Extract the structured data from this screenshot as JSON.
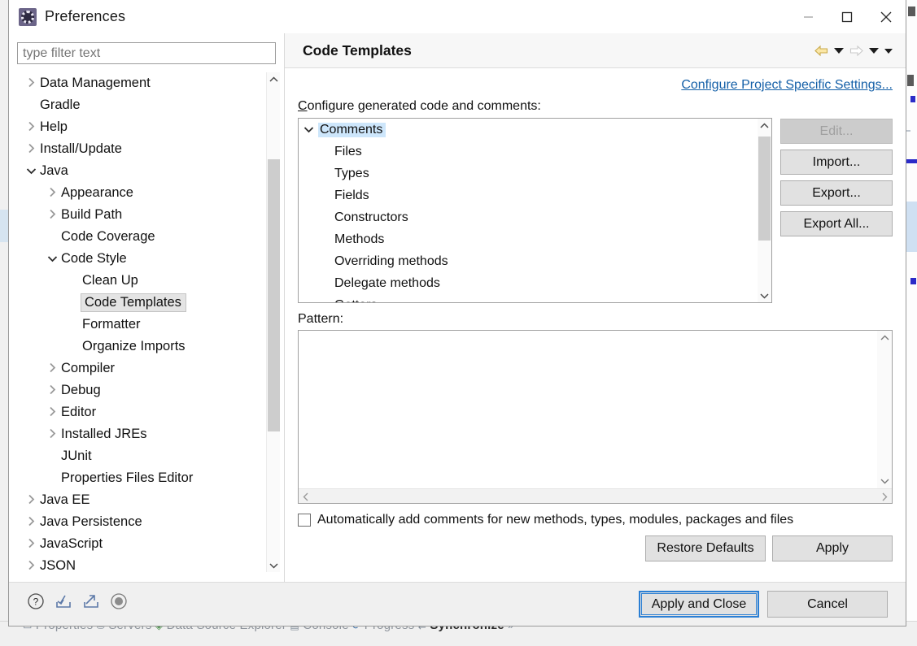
{
  "window": {
    "title": "Preferences",
    "icon": "preferences-gear-icon",
    "controls": {
      "minimize": "–",
      "maximize": "▢",
      "close": "✕"
    }
  },
  "sidebar": {
    "filter": {
      "placeholder": "type filter text",
      "value": ""
    },
    "items": [
      {
        "label": "Data Management",
        "level": 0,
        "arrow": "collapsed",
        "selected": false
      },
      {
        "label": "Gradle",
        "level": 0,
        "arrow": "none",
        "selected": false
      },
      {
        "label": "Help",
        "level": 0,
        "arrow": "collapsed",
        "selected": false
      },
      {
        "label": "Install/Update",
        "level": 0,
        "arrow": "collapsed",
        "selected": false
      },
      {
        "label": "Java",
        "level": 0,
        "arrow": "expanded",
        "selected": false
      },
      {
        "label": "Appearance",
        "level": 1,
        "arrow": "collapsed",
        "selected": false
      },
      {
        "label": "Build Path",
        "level": 1,
        "arrow": "collapsed",
        "selected": false
      },
      {
        "label": "Code Coverage",
        "level": 1,
        "arrow": "none",
        "selected": false
      },
      {
        "label": "Code Style",
        "level": 1,
        "arrow": "expanded",
        "selected": false
      },
      {
        "label": "Clean Up",
        "level": 2,
        "arrow": "none",
        "selected": false
      },
      {
        "label": "Code Templates",
        "level": 2,
        "arrow": "none",
        "selected": true
      },
      {
        "label": "Formatter",
        "level": 2,
        "arrow": "none",
        "selected": false
      },
      {
        "label": "Organize Imports",
        "level": 2,
        "arrow": "none",
        "selected": false
      },
      {
        "label": "Compiler",
        "level": 1,
        "arrow": "collapsed",
        "selected": false
      },
      {
        "label": "Debug",
        "level": 1,
        "arrow": "collapsed",
        "selected": false
      },
      {
        "label": "Editor",
        "level": 1,
        "arrow": "collapsed",
        "selected": false
      },
      {
        "label": "Installed JREs",
        "level": 1,
        "arrow": "collapsed",
        "selected": false
      },
      {
        "label": "JUnit",
        "level": 1,
        "arrow": "none",
        "selected": false
      },
      {
        "label": "Properties Files Editor",
        "level": 1,
        "arrow": "none",
        "selected": false
      },
      {
        "label": "Java EE",
        "level": 0,
        "arrow": "collapsed",
        "selected": false
      },
      {
        "label": "Java Persistence",
        "level": 0,
        "arrow": "collapsed",
        "selected": false
      },
      {
        "label": "JavaScript",
        "level": 0,
        "arrow": "collapsed",
        "selected": false
      },
      {
        "label": "JSON",
        "level": 0,
        "arrow": "collapsed",
        "selected": false
      }
    ]
  },
  "page": {
    "title": "Code Templates",
    "nav": {
      "back": "back-arrow-icon",
      "back_menu": "back-dropdown-icon",
      "forward": "forward-arrow-icon",
      "forward_menu": "forward-dropdown-icon",
      "view_menu": "view-menu-dropdown-icon"
    },
    "project_specific_link": "Configure Project Specific Settings...",
    "configure_label": "Configure generated code and comments:",
    "templates": [
      {
        "label": "Comments",
        "level": 0,
        "arrow": "expanded",
        "selected": true
      },
      {
        "label": "Files",
        "level": 1,
        "arrow": "none",
        "selected": false
      },
      {
        "label": "Types",
        "level": 1,
        "arrow": "none",
        "selected": false
      },
      {
        "label": "Fields",
        "level": 1,
        "arrow": "none",
        "selected": false
      },
      {
        "label": "Constructors",
        "level": 1,
        "arrow": "none",
        "selected": false
      },
      {
        "label": "Methods",
        "level": 1,
        "arrow": "none",
        "selected": false
      },
      {
        "label": "Overriding methods",
        "level": 1,
        "arrow": "none",
        "selected": false
      },
      {
        "label": "Delegate methods",
        "level": 1,
        "arrow": "none",
        "selected": false
      },
      {
        "label": "Getters",
        "level": 1,
        "arrow": "none",
        "selected": false
      }
    ],
    "side_buttons": [
      {
        "label": "Edit...",
        "disabled": true
      },
      {
        "label": "Import...",
        "disabled": false
      },
      {
        "label": "Export...",
        "disabled": false
      },
      {
        "label": "Export All...",
        "disabled": false
      }
    ],
    "pattern_label": "Pattern:",
    "pattern_value": "",
    "auto_comments": {
      "label": "Automatically add comments for new methods, types, modules, packages and files",
      "checked": false
    },
    "restore_defaults": "Restore Defaults",
    "apply": "Apply"
  },
  "footer": {
    "icons": [
      "help-icon",
      "import-icon",
      "export-icon",
      "settings-gear-icon"
    ],
    "apply_and_close": "Apply and Close",
    "cancel": "Cancel"
  },
  "backdrop": {
    "view_tabs": [
      "Properties",
      "Servers",
      "Data Source Explorer",
      "Console",
      "Progress",
      "Synchronize"
    ]
  },
  "colors": {
    "accent_link": "#1560a8",
    "focus_border": "#2b7fd4",
    "selection_blue": "#cde6fb",
    "dialog_bg": "#f0f0f0"
  }
}
